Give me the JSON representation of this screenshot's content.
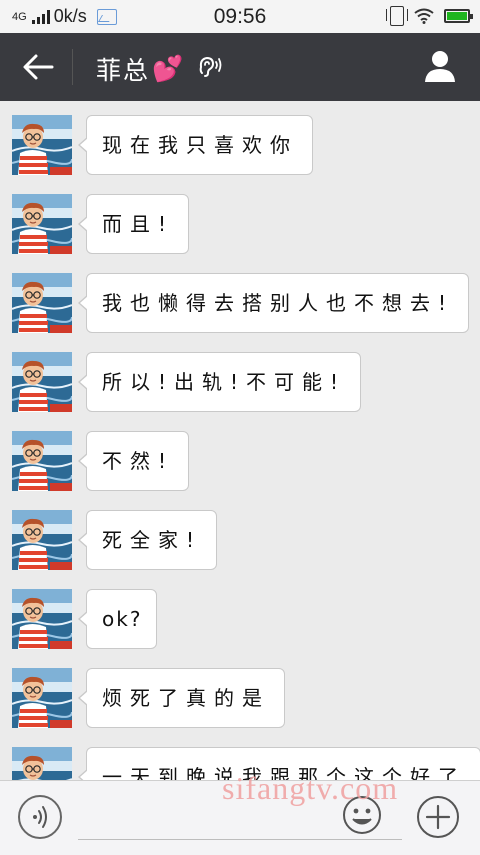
{
  "status_bar": {
    "network": "4G",
    "speed": "0k/s",
    "time": "09:56"
  },
  "header": {
    "title": "菲总",
    "title_emoji": "💕",
    "colors": {
      "bar": "#393a3f",
      "text": "#ffffff"
    }
  },
  "messages": [
    {
      "text": "现在我只喜欢你"
    },
    {
      "text": "而且!"
    },
    {
      "text": "我也懒得去搭别人也不想去!"
    },
    {
      "text": "所以!出轨!不可能!"
    },
    {
      "text": "不然!"
    },
    {
      "text": "死全家!"
    },
    {
      "text": "ok?"
    },
    {
      "text": "烦死了真的是"
    },
    {
      "text": "一天到晚说我跟那个这个好了"
    }
  ],
  "input_bar": {
    "input_value": ""
  },
  "watermark": "sifangtv.com",
  "colors": {
    "chat_bg": "#ebebeb",
    "bubble": "#ffffff",
    "battery": "#1fb51f"
  }
}
